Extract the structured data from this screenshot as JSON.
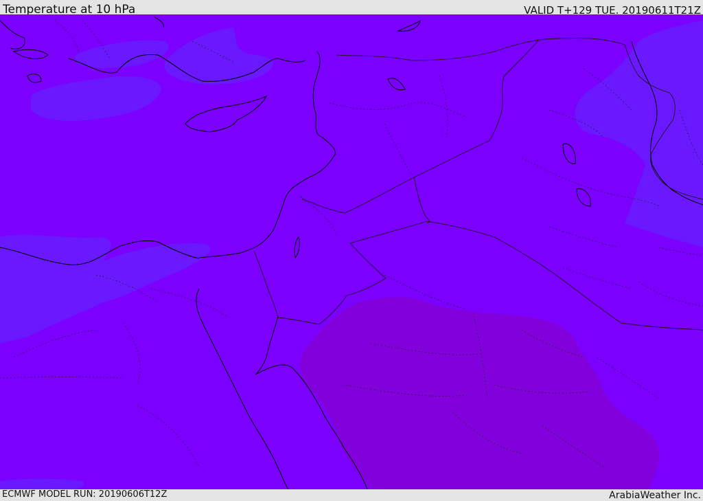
{
  "header": {
    "title": "Temperature at 10 hPa",
    "valid_time": "VALID T+129 TUE. 20190611T21Z"
  },
  "footer": {
    "model_run": "ECMWF MODEL RUN: 20190606T12Z",
    "credit": "ArabiaWeather Inc."
  },
  "map": {
    "colors": {
      "base_field": "#7b00ff",
      "cool_field": "#6a18ff",
      "warm_field": "#8100dc",
      "coastline": "#000000",
      "border": "#1a1a1a"
    },
    "field_regions": [
      "cool-east",
      "cool-west",
      "cool-north",
      "warm-south"
    ]
  }
}
